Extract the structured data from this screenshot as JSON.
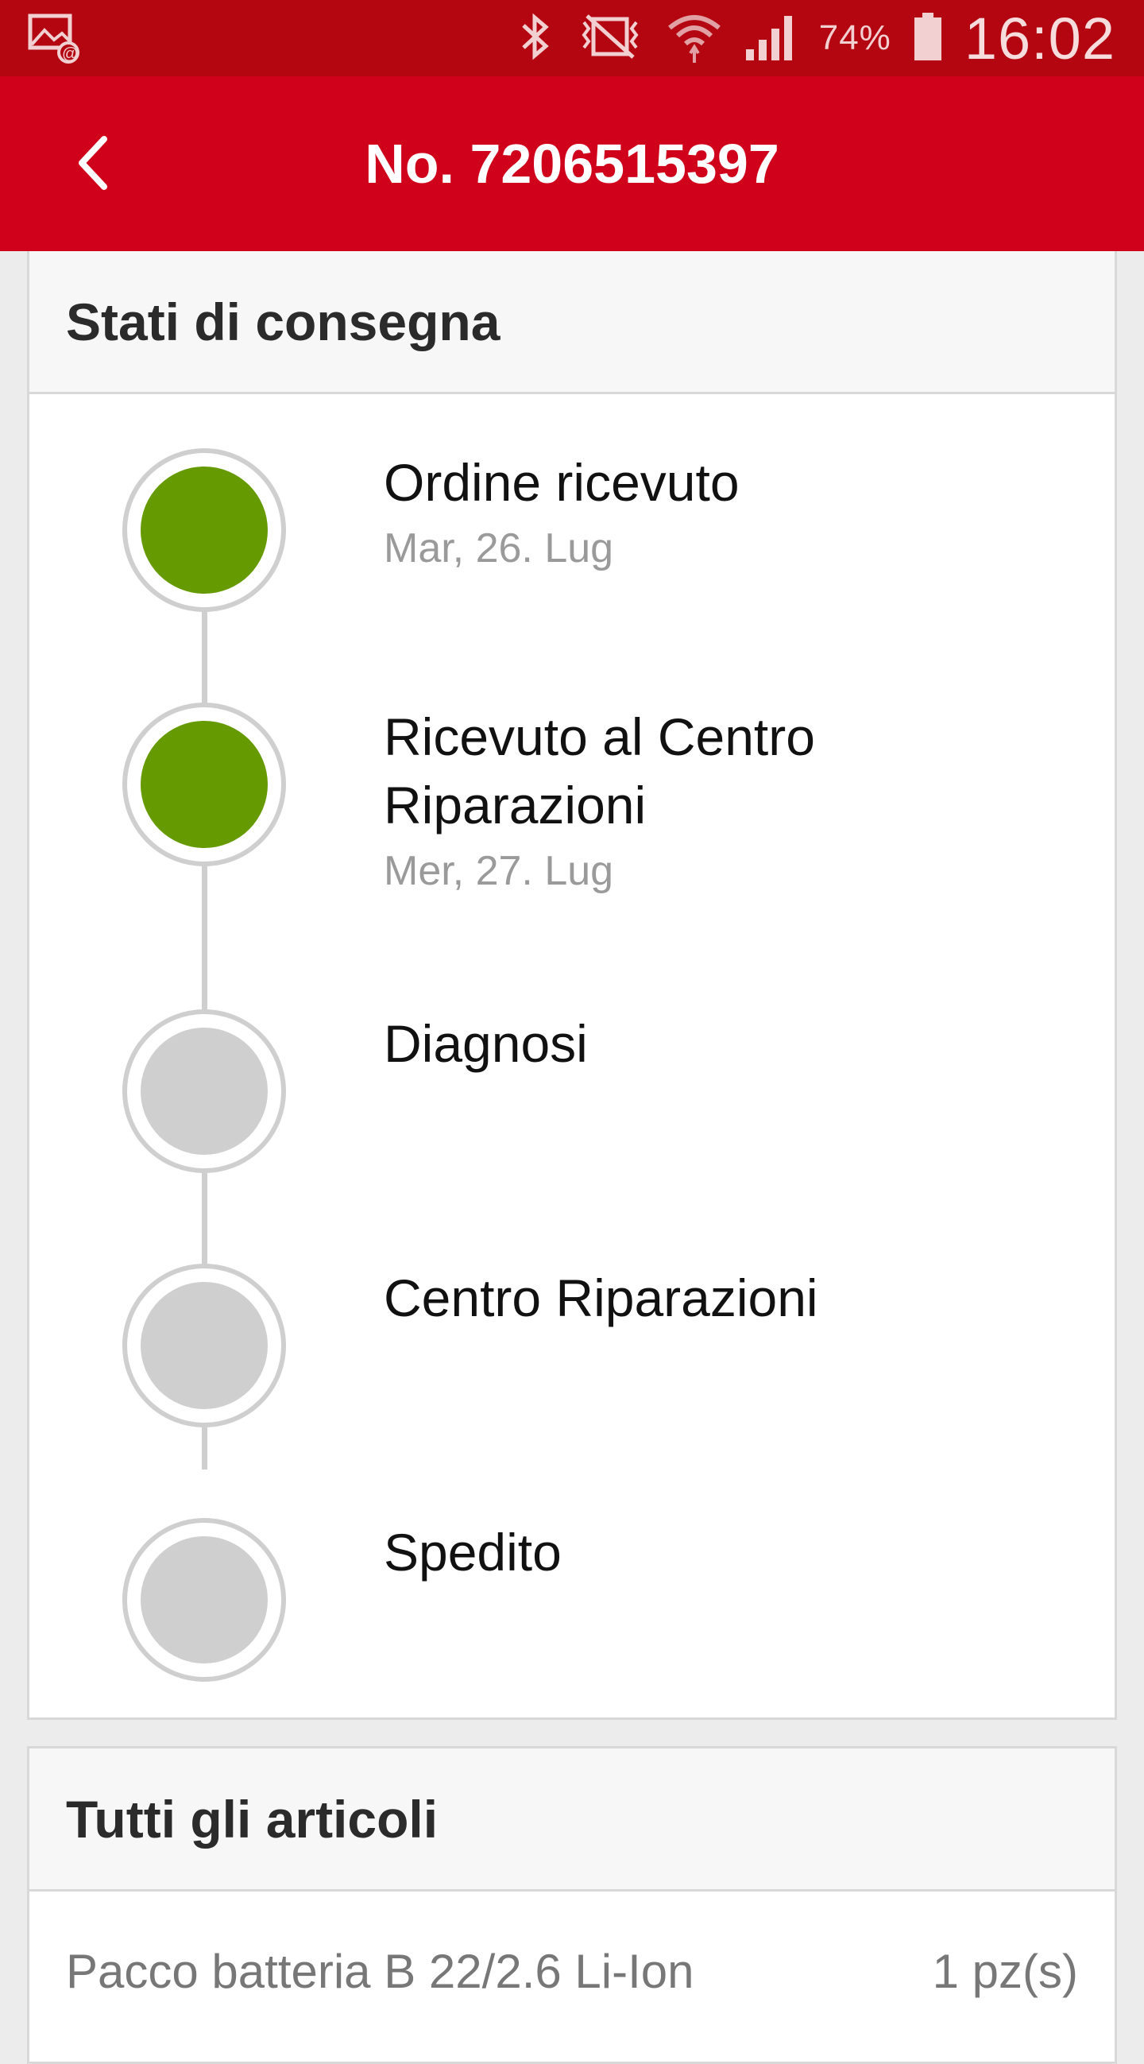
{
  "status_bar": {
    "battery_percent": "74%",
    "time": "16:02",
    "icons": [
      "image-mail-notification-icon",
      "bluetooth-icon",
      "vibrate-mute-icon",
      "wifi-icon",
      "signal-icon",
      "battery-icon"
    ]
  },
  "app_bar": {
    "back_icon": "chevron-left-icon",
    "title": "No. 7206515397"
  },
  "delivery_status": {
    "heading": "Stati di consegna",
    "steps": [
      {
        "label": "Ordine ricevuto",
        "date": "Mar, 26. Lug",
        "state": "done"
      },
      {
        "label": "Ricevuto al Centro Riparazioni",
        "date": "Mer, 27. Lug",
        "state": "done"
      },
      {
        "label": "Diagnosi",
        "date": "",
        "state": "pending"
      },
      {
        "label": "Centro Riparazioni",
        "date": "",
        "state": "pending"
      },
      {
        "label": "Spedito",
        "date": "",
        "state": "pending"
      }
    ]
  },
  "all_items": {
    "heading": "Tutti gli articoli",
    "items": [
      {
        "name": "Pacco batteria B 22/2.6 Li-Ion",
        "quantity": "1 pz(s)"
      }
    ]
  },
  "colors": {
    "status_bar": "#b30610",
    "app_bar": "#d0021b",
    "done": "#659a00",
    "pending": "#cfcfcf"
  }
}
